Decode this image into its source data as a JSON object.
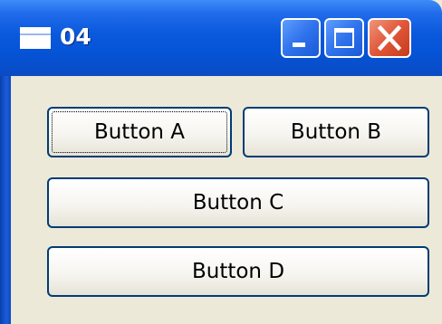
{
  "window": {
    "title": "04",
    "app_icon": "window-icon",
    "controls": {
      "minimize_icon": "minimize-icon",
      "maximize_icon": "maximize-icon",
      "close_icon": "close-icon"
    }
  },
  "buttons": [
    {
      "label": "Button A",
      "focused": true
    },
    {
      "label": "Button B",
      "focused": false
    },
    {
      "label": "Button C",
      "focused": false
    },
    {
      "label": "Button D",
      "focused": false
    }
  ],
  "colors": {
    "titlebar": "#0553D6",
    "client_background": "#ECE9D8",
    "button_border": "#003C74",
    "close_button": "#E0573A"
  }
}
